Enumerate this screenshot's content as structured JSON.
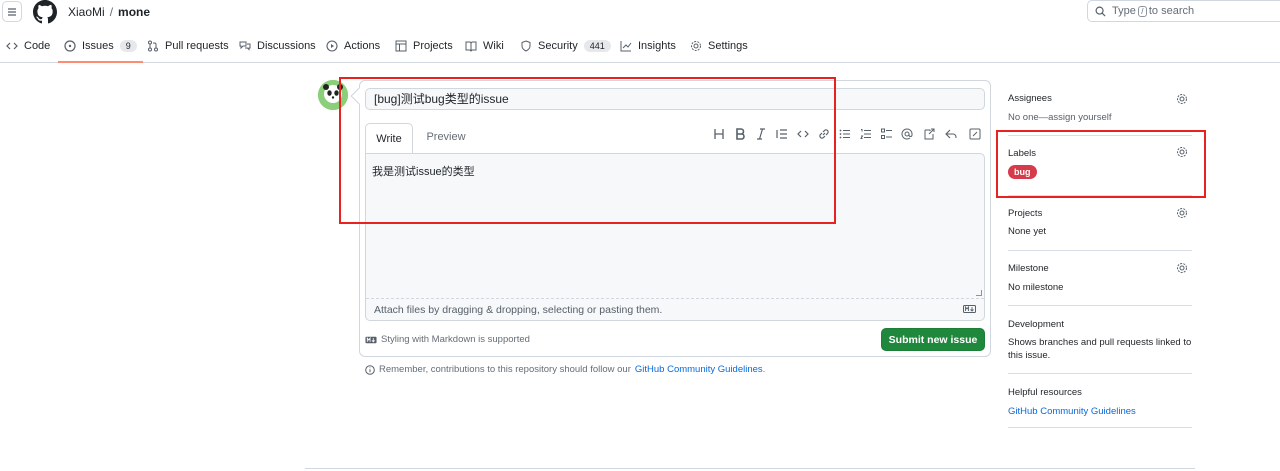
{
  "header": {
    "owner": "XiaoMi",
    "separator": "/",
    "repo": "mone",
    "search_prefix": "Type",
    "search_key": "/",
    "search_suffix": "to search"
  },
  "nav": {
    "code": "Code",
    "issues": "Issues",
    "issues_count": "9",
    "pull_requests": "Pull requests",
    "discussions": "Discussions",
    "actions": "Actions",
    "projects": "Projects",
    "wiki": "Wiki",
    "security": "Security",
    "security_count": "441",
    "insights": "Insights",
    "settings": "Settings"
  },
  "form": {
    "title_value": "[bug]测试bug类型的issue",
    "tab_write": "Write",
    "tab_preview": "Preview",
    "body_text": "我是测试issue的类型",
    "attach_hint": "Attach files by dragging & dropping, selecting or pasting them.",
    "markdown_note": "Styling with Markdown is supported",
    "submit_label": "Submit new issue",
    "remember_text": "Remember, contributions to this repository should follow our",
    "guidelines_link": "GitHub Community Guidelines",
    "remember_end": "."
  },
  "toolbar_icons": [
    "heading-icon",
    "bold-icon",
    "italic-icon",
    "quote-icon",
    "code-icon",
    "link-icon",
    "unordered-list-icon",
    "ordered-list-icon",
    "task-list-icon",
    "mention-icon",
    "reference-icon",
    "reply-icon",
    "fullscreen-icon"
  ],
  "sidebar": {
    "assignees_title": "Assignees",
    "assignees_value": "No one—assign yourself",
    "labels_title": "Labels",
    "label_bug": "bug",
    "label_bug_color": "#d73a4a",
    "projects_title": "Projects",
    "projects_value": "None yet",
    "milestone_title": "Milestone",
    "milestone_value": "No milestone",
    "development_title": "Development",
    "development_value": "Shows branches and pull requests linked to this issue.",
    "helpful_title": "Helpful resources",
    "helpful_link": "GitHub Community Guidelines"
  },
  "colors": {
    "accent_tab_underline": "#fd8c73",
    "submit_green": "#1f883d",
    "link_blue": "#0969da",
    "annotation_red": "#e8231f"
  }
}
